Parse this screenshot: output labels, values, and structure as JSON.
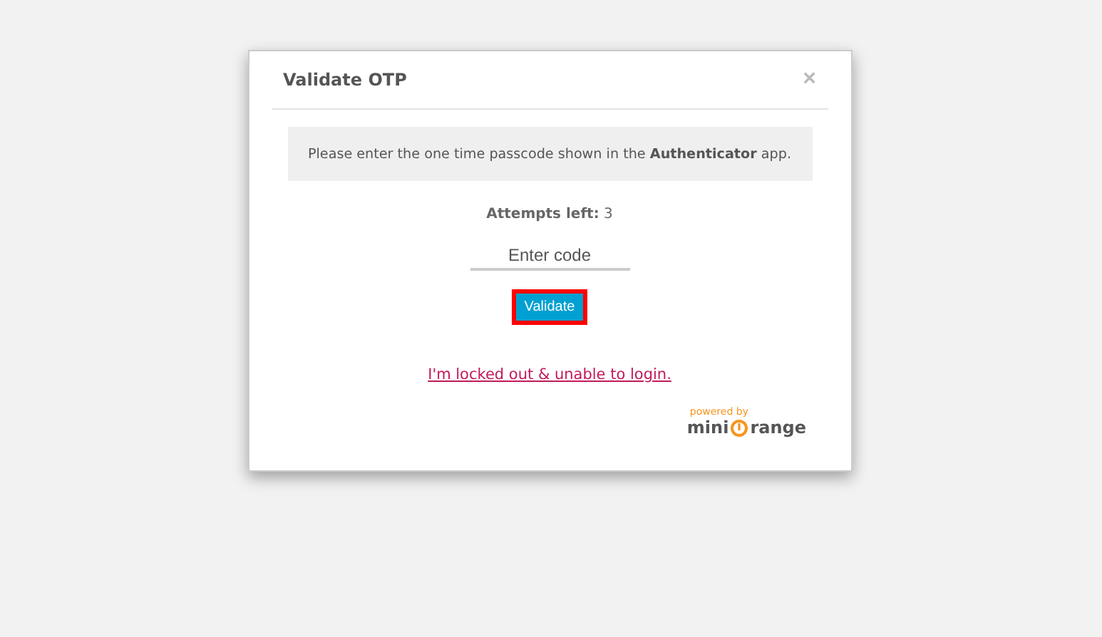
{
  "dialog": {
    "title": "Validate OTP",
    "close": "×",
    "message": "Please enter the one time passcode shown in the **Authenticator** app.",
    "attempts_label": "Attempts left:",
    "attempts": "3",
    "code_field": {
      "placeholder": "Enter code"
    },
    "submit": {
      "label": "Validate",
      "focused": true
    },
    "link": "I'm locked out & unable to login.",
    "logo": {
      "tagline": "powered by",
      "name_start": "mini",
      "name_end": "range"
    }
  }
}
